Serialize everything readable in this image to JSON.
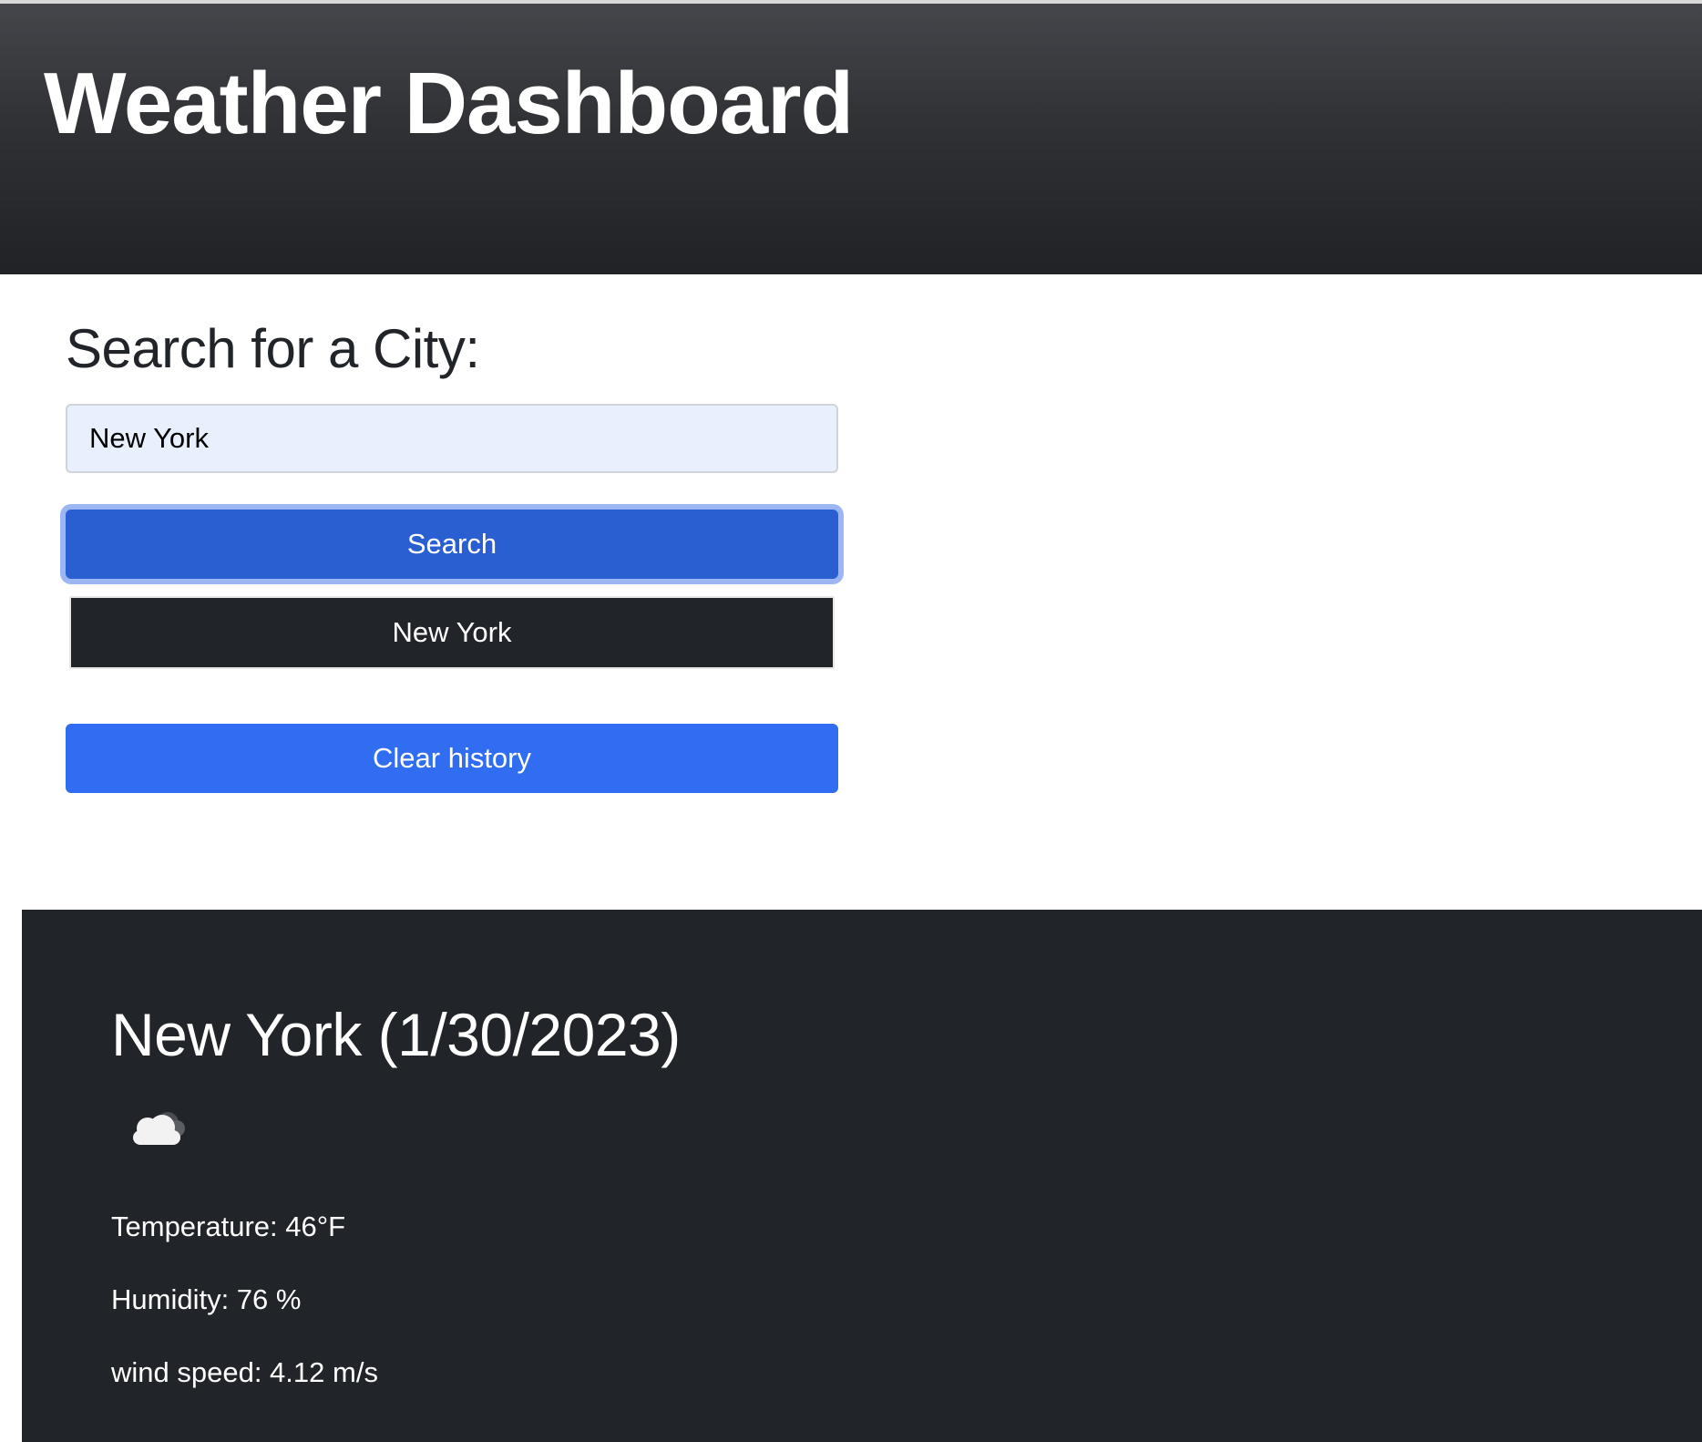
{
  "header": {
    "title": "Weather Dashboard"
  },
  "search": {
    "heading": "Search for a City:",
    "input_value": "New York",
    "search_button_label": "Search",
    "history": [
      "New York"
    ],
    "clear_button_label": "Clear history"
  },
  "current_weather": {
    "title": "New York (1/30/2023)",
    "icon": "cloud-icon",
    "temperature": "Temperature: 46°F",
    "humidity": "Humidity: 76 %",
    "wind_speed": "wind speed: 4.12 m/s"
  },
  "colors": {
    "search_button": "#2a5fd1",
    "clear_button": "#316df0",
    "history_button": "#212529",
    "panel_background": "#212529",
    "input_background": "#e8f0fe"
  }
}
